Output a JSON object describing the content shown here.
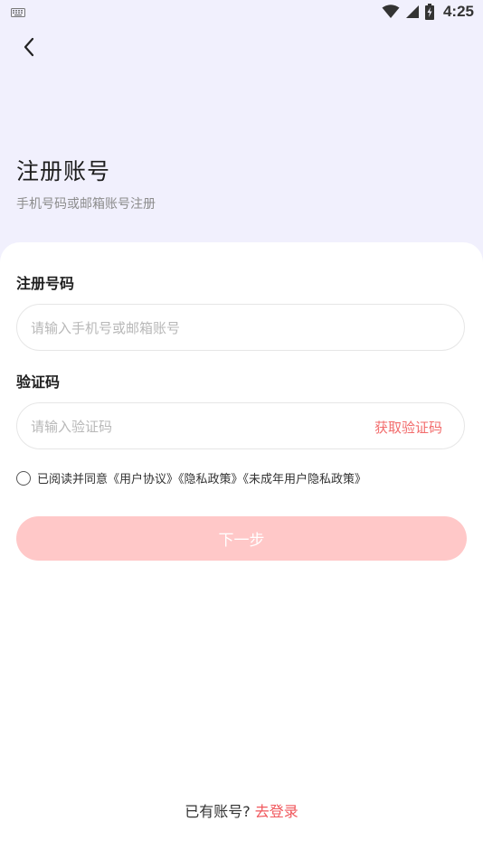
{
  "status_bar": {
    "time": "4:25",
    "icons": [
      "keyboard-icon",
      "wifi-icon",
      "signal-icon",
      "battery-icon"
    ]
  },
  "header": {
    "back_icon": "chevron-left-icon",
    "title": "注册账号",
    "subtitle": "手机号码或邮箱账号注册"
  },
  "form": {
    "phone_label": "注册号码",
    "phone_placeholder": "请输入手机号或邮箱账号",
    "phone_value": "",
    "code_label": "验证码",
    "code_placeholder": "请输入验证码",
    "code_value": "",
    "get_code_label": "获取验证码",
    "agreement": {
      "checked": false,
      "prefix": "已阅读并同意",
      "user_agreement": "《用户协议》",
      "privacy_policy": "《隐私政策》",
      "minor_privacy_policy": "《未成年用户隐私政策》"
    },
    "next_label": "下一步"
  },
  "footer": {
    "have_account_text": "已有账号?",
    "login_link": "去登录"
  },
  "colors": {
    "background_top": "#f1f0fd",
    "card": "#ffffff",
    "accent_red": "#f0575c",
    "next_button_disabled": "#ffc8c8"
  }
}
